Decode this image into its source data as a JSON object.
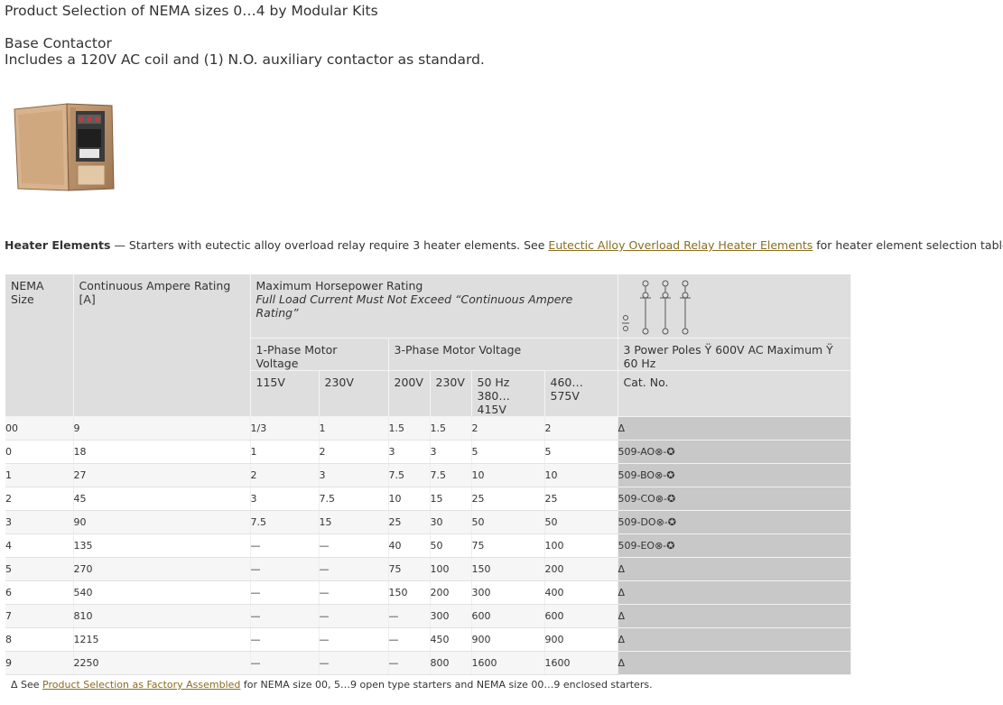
{
  "title": "Product Selection of NEMA sizes 0…4 by Modular Kits",
  "base": {
    "heading": "Base Contactor",
    "description": "Includes a 120V AC coil and (1) N.O. auxiliary contactor as standard."
  },
  "heater": {
    "label": "Heater Elements",
    "text_before": " — Starters with eutectic alloy overload relay require 3 heater elements. See ",
    "link": "Eutectic Alloy Overload Relay Heater Elements",
    "text_after": " for heater element selection tables."
  },
  "table": {
    "headers": {
      "nema": "NEMA Size",
      "amp": "Continuous Ampere Rating [A]",
      "hp_title": "Maximum Horsepower Rating",
      "hp_note": "Full Load Current Must Not Exceed “Continuous Ampere Rating”",
      "phase1": "1-Phase Motor Voltage",
      "phase3": "3-Phase Motor Voltage",
      "poles": "3 Power Poles Ÿ 600V AC Maximum Ÿ 60 Hz",
      "v115": "115V",
      "v230a": "230V",
      "v200": "200V",
      "v230b": "230V",
      "v50hz_1": "50 Hz",
      "v50hz_2": "380…415V",
      "v460": "460…575V",
      "cat": "Cat. No."
    },
    "rows": [
      [
        "00",
        "9",
        "1/3",
        "1",
        "1.5",
        "1.5",
        "2",
        "2",
        "Δ"
      ],
      [
        "0",
        "18",
        "1",
        "2",
        "3",
        "3",
        "5",
        "5",
        "509-AO⊗-✪"
      ],
      [
        "1",
        "27",
        "2",
        "3",
        "7.5",
        "7.5",
        "10",
        "10",
        "509-BO⊗-✪"
      ],
      [
        "2",
        "45",
        "3",
        "7.5",
        "10",
        "15",
        "25",
        "25",
        "509-CO⊗-✪"
      ],
      [
        "3",
        "90",
        "7.5",
        "15",
        "25",
        "30",
        "50",
        "50",
        "509-DO⊗-✪"
      ],
      [
        "4",
        "135",
        "—",
        "—",
        "40",
        "50",
        "75",
        "100",
        "509-EO⊗-✪"
      ],
      [
        "5",
        "270",
        "—",
        "—",
        "75",
        "100",
        "150",
        "200",
        "Δ"
      ],
      [
        "6",
        "540",
        "—",
        "—",
        "150",
        "200",
        "300",
        "400",
        "Δ"
      ],
      [
        "7",
        "810",
        "—",
        "—",
        "—",
        "300",
        "600",
        "600",
        "Δ"
      ],
      [
        "8",
        "1215",
        "—",
        "—",
        "—",
        "450",
        "900",
        "900",
        "Δ"
      ],
      [
        "9",
        "2250",
        "—",
        "—",
        "—",
        "800",
        "1600",
        "1600",
        "Δ"
      ]
    ]
  },
  "footnote": {
    "symbol": "Δ See ",
    "link": "Product Selection as Factory Assembled",
    "text": " for NEMA size 00, 5…9 open type starters and NEMA size 00…9 enclosed starters."
  },
  "colors": {
    "header_bg": "#dedede",
    "cat_bg": "#c8c8c8",
    "link": "#8a6d1f"
  }
}
